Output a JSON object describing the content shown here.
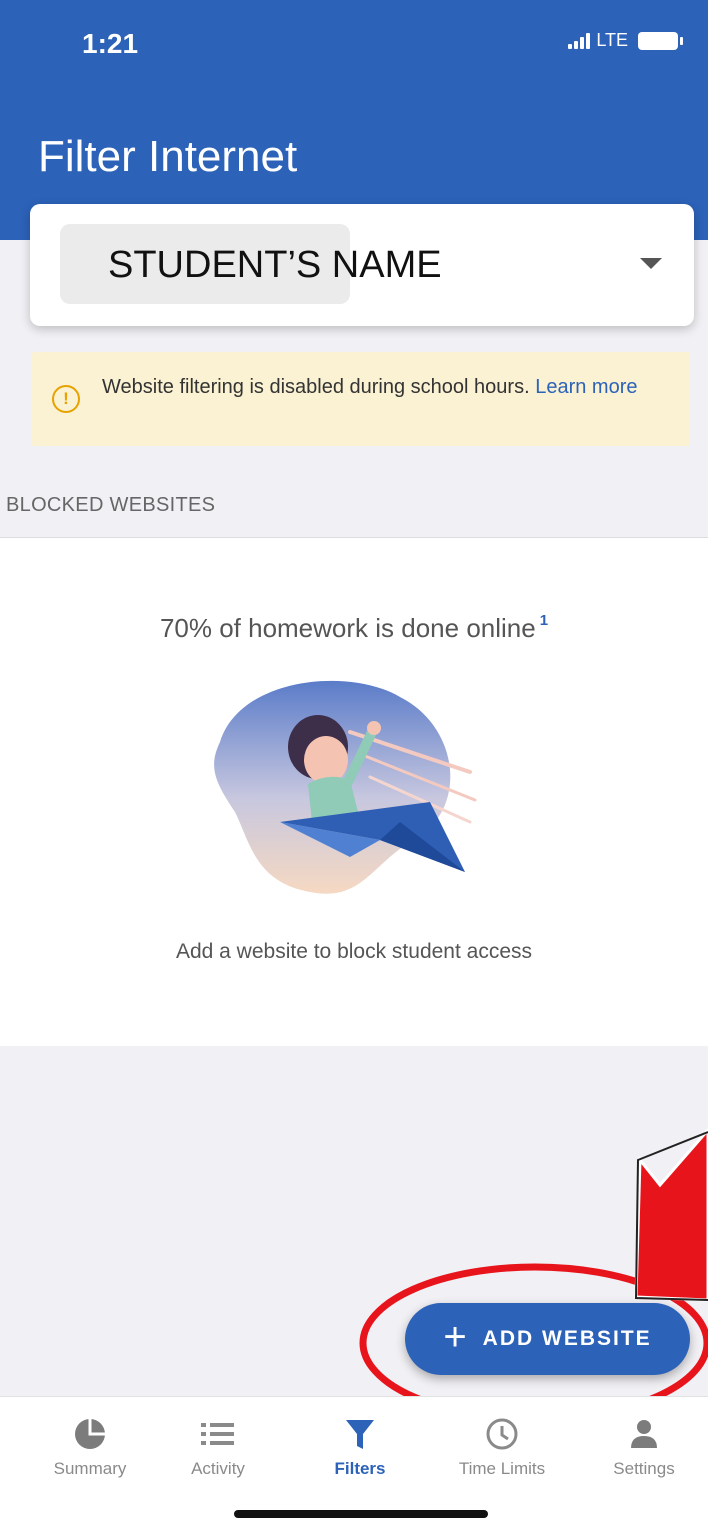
{
  "status_bar": {
    "time": "1:21",
    "network": "LTE"
  },
  "header": {
    "title": "Filter Internet"
  },
  "student_selector": {
    "name": "STUDENT’S NAME"
  },
  "notice": {
    "text": "Website filtering is disabled during school hours. ",
    "link": "Learn more"
  },
  "blocked_section": {
    "header": "BLOCKED WEBSITES",
    "stat": "70% of homework is done online",
    "footnote": "1",
    "caption": "Add a website to block student access"
  },
  "fab": {
    "plus": "+",
    "label": "ADD WEBSITE"
  },
  "bottom_nav": {
    "items": [
      {
        "label": "Summary",
        "icon": "pie-chart-icon"
      },
      {
        "label": "Activity",
        "icon": "list-icon"
      },
      {
        "label": "Filters",
        "icon": "filter-icon",
        "active": true
      },
      {
        "label": "Time Limits",
        "icon": "clock-icon"
      },
      {
        "label": "Settings",
        "icon": "person-icon"
      }
    ]
  },
  "colors": {
    "primary": "#2c62b8",
    "notice_bg": "#faf2d3",
    "warning": "#e8a200",
    "annotation_red": "#e8141c"
  }
}
